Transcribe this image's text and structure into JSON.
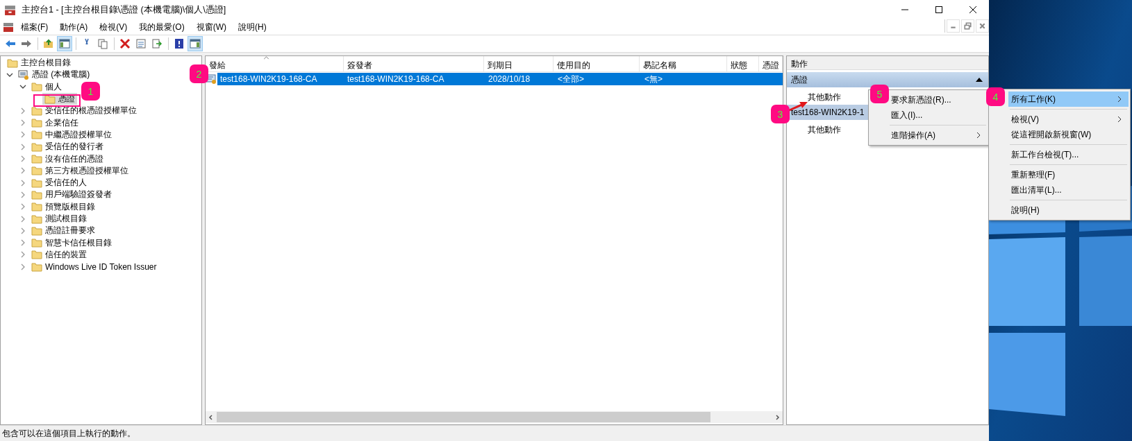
{
  "window": {
    "title": "主控台1 - [主控台根目錄\\憑證 (本機電腦)\\個人\\憑證]"
  },
  "menu_bar": [
    "檔案(F)",
    "動作(A)",
    "檢視(V)",
    "我的最愛(O)",
    "視窗(W)",
    "說明(H)"
  ],
  "toolbar": [
    {
      "pressed": false
    },
    {
      "pressed": false
    },
    {
      "pressed": false
    },
    {
      "pressed": true
    },
    {
      "pressed": false
    },
    {
      "pressed": false
    },
    {
      "pressed": false
    },
    {
      "pressed": false
    },
    {
      "pressed": false
    },
    {
      "pressed": false
    },
    {
      "pressed": true
    }
  ],
  "tree": [
    {
      "label": "主控台根目錄",
      "kind": "folder",
      "selected": false,
      "children": [
        {
          "label": "憑證 (本機電腦)",
          "kind": "snapin",
          "expanded": true,
          "selected": false,
          "children": [
            {
              "label": "個人",
              "kind": "folder",
              "expanded": true,
              "selected": false,
              "children": [
                {
                  "label": "憑證",
                  "kind": "folder",
                  "selected": true
                }
              ]
            },
            {
              "label": "受信任的根憑證授權單位",
              "kind": "folder",
              "expanded": false,
              "selected": false
            },
            {
              "label": "企業信任",
              "kind": "folder",
              "expanded": false,
              "selected": false
            },
            {
              "label": "中繼憑證授權單位",
              "kind": "folder",
              "expanded": false,
              "selected": false
            },
            {
              "label": "受信任的發行者",
              "kind": "folder",
              "expanded": false,
              "selected": false
            },
            {
              "label": "沒有信任的憑證",
              "kind": "folder",
              "expanded": false,
              "selected": false
            },
            {
              "label": "第三方根憑證授權單位",
              "kind": "folder",
              "expanded": false,
              "selected": false
            },
            {
              "label": "受信任的人",
              "kind": "folder",
              "expanded": false,
              "selected": false
            },
            {
              "label": "用戶端驗證簽發者",
              "kind": "folder",
              "expanded": false,
              "selected": false
            },
            {
              "label": "預覽版根目錄",
              "kind": "folder",
              "expanded": false,
              "selected": false
            },
            {
              "label": "測試根目錄",
              "kind": "folder",
              "expanded": false,
              "selected": false
            },
            {
              "label": "憑證註冊要求",
              "kind": "folder",
              "expanded": false,
              "selected": false
            },
            {
              "label": "智慧卡信任根目錄",
              "kind": "folder",
              "expanded": false,
              "selected": false
            },
            {
              "label": "信任的裝置",
              "kind": "folder",
              "expanded": false,
              "selected": false
            },
            {
              "label": "Windows Live ID Token Issuer",
              "kind": "folder",
              "expanded": false,
              "selected": false
            }
          ]
        }
      ]
    }
  ],
  "table": {
    "columns": [
      {
        "label": "發給",
        "sorted": true
      },
      {
        "label": "簽發者",
        "sorted": false
      },
      {
        "label": "到期日",
        "sorted": false
      },
      {
        "label": "使用目的",
        "sorted": false
      },
      {
        "label": "易記名稱",
        "sorted": false
      },
      {
        "label": "狀態",
        "sorted": false
      },
      {
        "label": "憑證",
        "sorted": false
      }
    ],
    "rows": [
      {
        "selected": true,
        "cells": [
          "test168-WIN2K19-168-CA",
          "test168-WIN2K19-168-CA",
          "2028/10/18",
          "<全部>",
          "<無>"
        ]
      }
    ]
  },
  "actions": {
    "title": "動作",
    "groups": [
      {
        "title": "憑證",
        "kind": "primary",
        "expanded": true,
        "items": [
          "其他動作"
        ]
      },
      {
        "title": "test168-WIN2K19-1",
        "kind": "secondary",
        "items": [
          "其他動作"
        ]
      }
    ]
  },
  "context_menus": [
    {
      "items": [
        {
          "kind": "item",
          "label": "要求新憑證(R)...",
          "submenu": false,
          "selected": false
        },
        {
          "kind": "item",
          "label": "匯入(I)...",
          "submenu": false,
          "selected": false
        },
        {
          "kind": "separator"
        },
        {
          "kind": "item",
          "label": "進階操作(A)",
          "submenu": true,
          "selected": false
        }
      ]
    },
    {
      "items": [
        {
          "kind": "item",
          "label": "所有工作(K)",
          "submenu": true,
          "selected": true
        },
        {
          "kind": "separator"
        },
        {
          "kind": "item",
          "label": "檢視(V)",
          "submenu": true,
          "selected": false
        },
        {
          "kind": "item",
          "label": "從這裡開啟新視窗(W)",
          "submenu": false,
          "selected": false
        },
        {
          "kind": "separator"
        },
        {
          "kind": "item",
          "label": "新工作台檢視(T)...",
          "submenu": false,
          "selected": false
        },
        {
          "kind": "separator"
        },
        {
          "kind": "item",
          "label": "重新整理(F)",
          "submenu": false,
          "selected": false
        },
        {
          "kind": "item",
          "label": "匯出清單(L)...",
          "submenu": false,
          "selected": false
        },
        {
          "kind": "separator"
        },
        {
          "kind": "item",
          "label": "說明(H)",
          "submenu": false,
          "selected": false
        }
      ]
    }
  ],
  "status_bar": "包含可以在這個項目上執行的動作。",
  "annotations": [
    "1",
    "2",
    "3",
    "4",
    "5"
  ]
}
